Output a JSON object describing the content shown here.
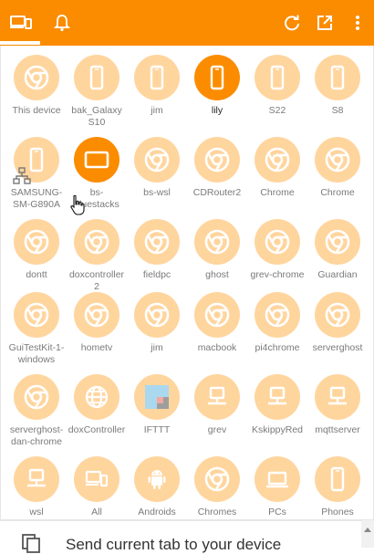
{
  "colors": {
    "accent": "#fb8c00",
    "light": "#ffd59e"
  },
  "header": {
    "tabs": [
      {
        "name": "devices-tab",
        "icon": "devices-icon",
        "active": true
      },
      {
        "name": "notifications-tab",
        "icon": "bell-icon",
        "active": false
      }
    ],
    "actions": [
      "refresh-icon",
      "open-in-new-icon",
      "more-vert-icon"
    ]
  },
  "devices": [
    {
      "label": "This device",
      "icon": "chrome"
    },
    {
      "label": "bak_Galaxy S10",
      "icon": "phone"
    },
    {
      "label": "jim",
      "icon": "phone"
    },
    {
      "label": "lily",
      "icon": "phone",
      "selected": true
    },
    {
      "label": "S22",
      "icon": "phone"
    },
    {
      "label": "S8",
      "icon": "phone"
    },
    {
      "label": "SAMSUNG-SM-G890A",
      "icon": "phone"
    },
    {
      "label": "bs-bluestacks",
      "icon": "tablet",
      "hover": true
    },
    {
      "label": "bs-wsl",
      "icon": "chrome"
    },
    {
      "label": "CDRouter2",
      "icon": "chrome"
    },
    {
      "label": "Chrome",
      "icon": "chrome"
    },
    {
      "label": "Chrome",
      "icon": "chrome"
    },
    {
      "label": "dontt",
      "icon": "chrome"
    },
    {
      "label": "doxcontroller2",
      "icon": "chrome"
    },
    {
      "label": "fieldpc",
      "icon": "chrome"
    },
    {
      "label": "ghost",
      "icon": "chrome"
    },
    {
      "label": "grev-chrome",
      "icon": "chrome"
    },
    {
      "label": "Guardian",
      "icon": "chrome"
    },
    {
      "label": "GuiTestKit-1-windows",
      "icon": "chrome"
    },
    {
      "label": "hometv",
      "icon": "chrome"
    },
    {
      "label": "jim",
      "icon": "chrome"
    },
    {
      "label": "macbook",
      "icon": "chrome"
    },
    {
      "label": "pi4chrome",
      "icon": "chrome"
    },
    {
      "label": "serverghost",
      "icon": "chrome"
    },
    {
      "label": "serverghost-dan-chrome",
      "icon": "chrome"
    },
    {
      "label": "doxController",
      "icon": "globe"
    },
    {
      "label": "IFTTT",
      "icon": "ifttt"
    },
    {
      "label": "grev",
      "icon": "network"
    },
    {
      "label": "KskippyRed",
      "icon": "network"
    },
    {
      "label": "mqttserver",
      "icon": "network"
    },
    {
      "label": "wsl",
      "icon": "network"
    },
    {
      "label": "All",
      "icon": "devices"
    },
    {
      "label": "Androids",
      "icon": "android"
    },
    {
      "label": "Chromes",
      "icon": "chrome"
    },
    {
      "label": "PCs",
      "icon": "laptop"
    },
    {
      "label": "Phones",
      "icon": "phone"
    }
  ],
  "bottom": {
    "text": "Send current tab to your device"
  }
}
